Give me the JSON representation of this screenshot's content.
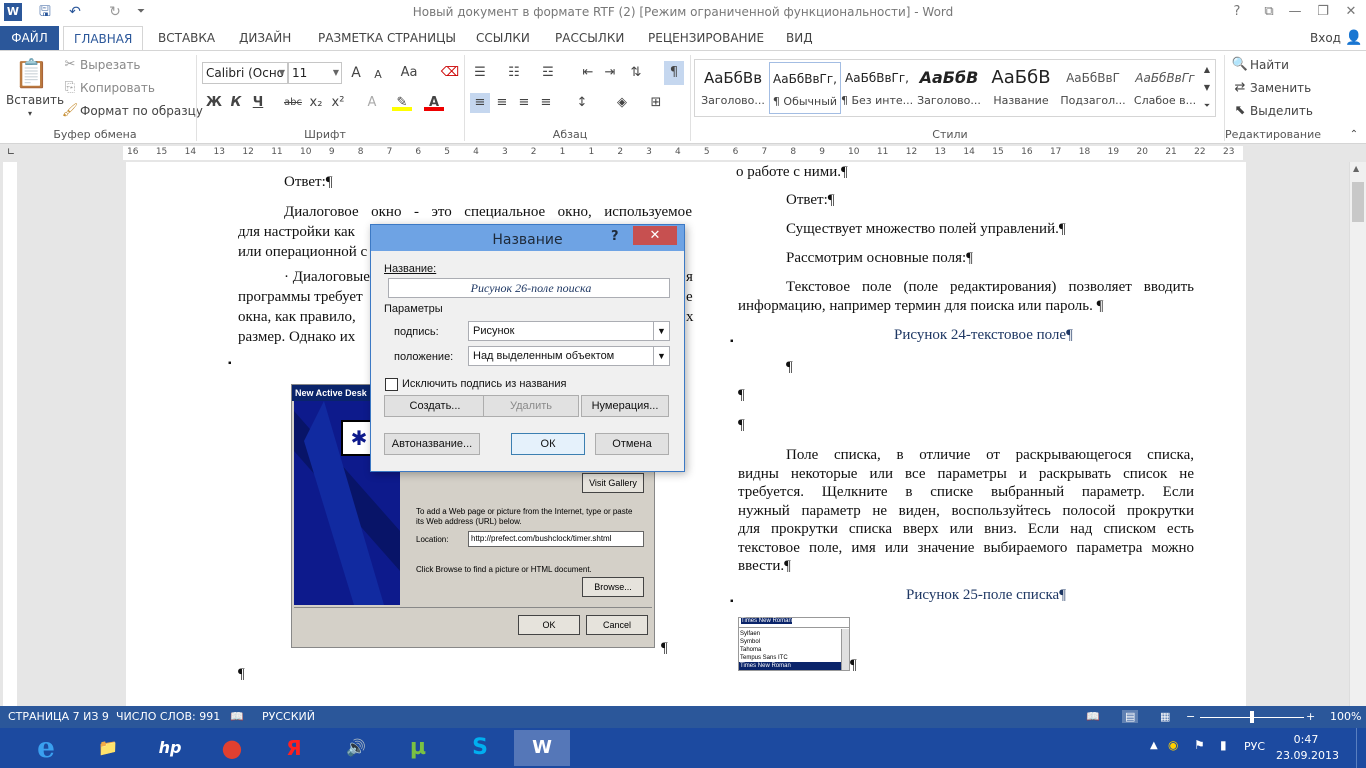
{
  "window": {
    "title": "Новый документ в формате RTF (2) [Режим ограниченной функциональности] - Word",
    "help_glyph": "?",
    "min_glyph": "—",
    "restore_glyph": "❐",
    "close_glyph": "✕"
  },
  "tabs": [
    "ФАЙЛ",
    "ГЛАВНАЯ",
    "ВСТАВКА",
    "ДИЗАЙН",
    "РАЗМЕТКА СТРАНИЦЫ",
    "ССЫЛКИ",
    "РАССЫЛКИ",
    "РЕЦЕНЗИРОВАНИЕ",
    "ВИД"
  ],
  "signin": "Вход",
  "clipboard": {
    "paste": "Вставить",
    "cut": "Вырезать",
    "copy": "Копировать",
    "format_painter": "Формат по образцу",
    "group": "Буфер обмена"
  },
  "font": {
    "name": "Calibri (Осно",
    "size": "11",
    "group": "Шрифт",
    "grow": "A",
    "shrink": "A",
    "case": "Aa",
    "bold": "Ж",
    "italic": "К",
    "underline": "Ч",
    "strike": "abc",
    "sub": "x₂",
    "sup": "x²"
  },
  "paragraph": {
    "group": "Абзац",
    "pilcrow": "¶"
  },
  "styles": {
    "group": "Стили",
    "items": [
      {
        "sample": "АаБбВв",
        "name": "Заголово..."
      },
      {
        "sample": "АаБбВвГг,",
        "name": "¶ Обычный"
      },
      {
        "sample": "АаБбВвГг,",
        "name": "¶ Без инте..."
      },
      {
        "sample": "АаБбВ",
        "name": "Заголово..."
      },
      {
        "sample": "АаБбВ",
        "name": "Название"
      },
      {
        "sample": "АаБбВвГ",
        "name": "Подзагол..."
      },
      {
        "sample": "АаБбВвГг",
        "name": "Слабое в..."
      }
    ]
  },
  "editing": {
    "find": "Найти",
    "replace": "Заменить",
    "select": "Выделить",
    "group": "Редактирование"
  },
  "ruler_numbers": [
    "16",
    "15",
    "14",
    "13",
    "12",
    "11",
    "10",
    "9",
    "8",
    "7",
    "6",
    "5",
    "4",
    "3",
    "2",
    "1",
    "1",
    "2",
    "3",
    "4",
    "5",
    "6",
    "7",
    "8",
    "9",
    "10",
    "11",
    "12",
    "13",
    "14",
    "15",
    "16",
    "17",
    "18",
    "19",
    "20",
    "21",
    "22",
    "23"
  ],
  "document": {
    "left": {
      "answer": "Ответ:¶",
      "p1": "Диалоговое окно - это специальное окно, используемое для настройки как... или операционной с...",
      "p1_l1": "Диалоговое окно - это специальное окно, используемое",
      "p1_l2": "для настройки как",
      "p1_l3": "или операционной с",
      "p2_l1": "· Диалоговые",
      "p2_l1b": "я",
      "p2_l2": "программы требует",
      "p2_l2b": "е",
      "p2_l3": "окна, как правило,",
      "p2_l3b": "х",
      "p2_l4": "размер. Однако их",
      "pilcrow": "¶"
    },
    "right": {
      "top": "о работе с ними.¶",
      "answer": "Ответ:¶",
      "l1": "Существует множество полей управлений.¶",
      "l2": "Рассмотрим основные поля:¶",
      "l3a": "Текстовое поле (поле редактирования) позволяет вводить",
      "l3b": "информацию, например термин для поиска или пароль. ¶",
      "cap24": "Рисунок 24-текстовое поле¶",
      "pil": "¶",
      "lb1": "Поле списка, в отличие от раскрывающегося списка,",
      "lb2": "видны некоторые или все параметры и раскрывать список не",
      "lb3": "требуется. Щелкните в списке выбранный параметр. Если",
      "lb4": "нужный параметр не виден, воспользуйтесь полосой прокрутки",
      "lb5": "для прокрутки списка вверх или вниз. Если над списком есть",
      "lb6": "текстовое поле, имя или значение выбираемого параметра можно",
      "lb7": "ввести.¶",
      "cap25": "Рисунок 25-поле списка¶"
    },
    "embedded_dialog": {
      "title": "New Active Desk",
      "gallery": "Visit Gallery",
      "text1": "To add a Web page or picture from the Internet, type or paste its Web address (URL) below.",
      "location_label": "Location:",
      "location_value": "http://prefect.com/bushclock/timer.shtml",
      "text2": "Click Browse to find a picture or HTML document.",
      "browse": "Browse...",
      "ok": "OK",
      "cancel": "Cancel"
    },
    "fontlist": {
      "value": "Times New Roman",
      "items": [
        "Sylfaen",
        "Symbol",
        "Tahoma",
        "Tempus Sans ITC",
        "Times New Roman"
      ]
    }
  },
  "dialog": {
    "title": "Название",
    "help": "?",
    "caption_label": "Название:",
    "caption_value": "Рисунок 26-поле поиска",
    "params": "Параметры",
    "label_label": "подпись:",
    "label_value": "Рисунок",
    "position_label": "положение:",
    "position_value": "Над выделенным объектом",
    "exclude": "Исключить подпись из названия",
    "btn_new": "Создать...",
    "btn_delete": "Удалить",
    "btn_numbering": "Нумерация...",
    "btn_autocaption": "Автоназвание...",
    "btn_ok": "ОК",
    "btn_cancel": "Отмена"
  },
  "statusbar": {
    "page": "СТРАНИЦА 7 ИЗ 9",
    "words": "ЧИСЛО СЛОВ: 991",
    "lang": "РУССКИЙ",
    "zoom": "100%"
  },
  "taskbar": {
    "lang": "РУС",
    "time": "0:47",
    "date": "23.09.2013",
    "apps": [
      "e",
      "📁",
      "hp",
      "●",
      "Я",
      "🔊",
      "µ",
      "S",
      "W"
    ]
  },
  "colors": {
    "accent": "#2b579a",
    "caption_text": "#1f3864",
    "close_red": "#c75050"
  }
}
